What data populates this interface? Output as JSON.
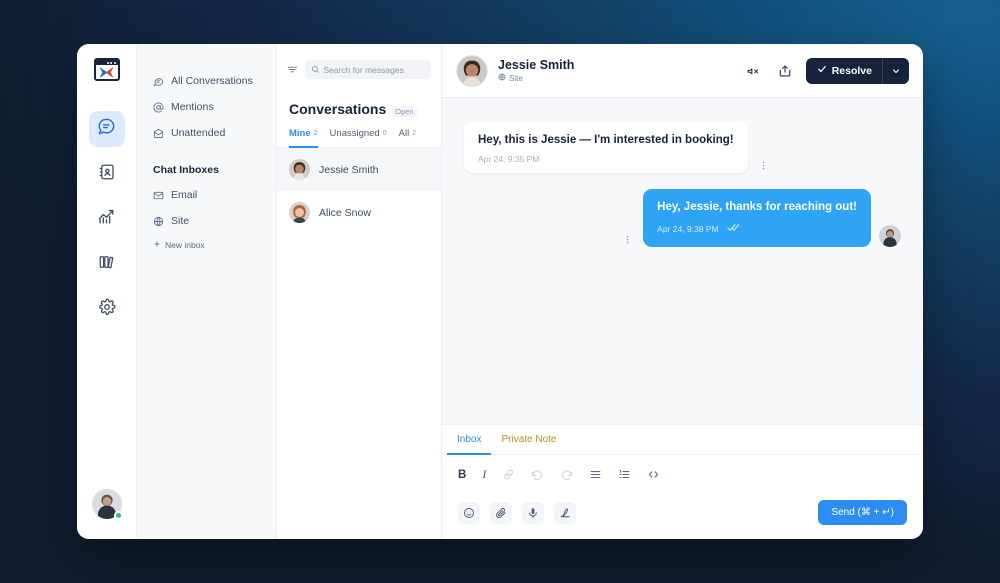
{
  "rail": {
    "logo_name": "app-logo",
    "items": [
      {
        "name": "conversations",
        "icon": "chat-icon",
        "active": true
      },
      {
        "name": "contacts",
        "icon": "contact-book-icon",
        "active": false
      },
      {
        "name": "reports",
        "icon": "chart-trend-icon",
        "active": false
      },
      {
        "name": "campaigns",
        "icon": "books-icon",
        "active": false
      },
      {
        "name": "settings",
        "icon": "gear-icon",
        "active": false
      }
    ],
    "avatar_status": "online"
  },
  "nav": {
    "items": [
      {
        "label": "All Conversations",
        "icon": "chat-bubble-icon"
      },
      {
        "label": "Mentions",
        "icon": "at-icon"
      },
      {
        "label": "Unattended",
        "icon": "envelope-open-icon"
      }
    ],
    "section_title": "Chat Inboxes",
    "inboxes": [
      {
        "label": "Email",
        "icon": "envelope-icon"
      },
      {
        "label": "Site",
        "icon": "globe-icon"
      }
    ],
    "new_inbox_label": "New inbox"
  },
  "conversation_list": {
    "search_placeholder": "Search for messages",
    "title": "Conversations",
    "status_badge": "Open",
    "tabs": [
      {
        "label": "Mine",
        "count": "2",
        "active": true
      },
      {
        "label": "Unassigned",
        "count": "0",
        "active": false
      },
      {
        "label": "All",
        "count": "2",
        "active": false
      }
    ],
    "rows": [
      {
        "name": "Jessie Smith",
        "selected": true
      },
      {
        "name": "Alice Snow",
        "selected": false
      }
    ]
  },
  "chat_header": {
    "contact_name": "Jessie Smith",
    "channel": "Site",
    "mute_icon": "speaker-mute-icon",
    "share_icon": "share-icon",
    "resolve_label": "Resolve"
  },
  "messages": [
    {
      "direction": "in",
      "text": "Hey, this is Jessie — I'm interested in booking!",
      "time": "Apr 24, 9:35 PM",
      "receipt": ""
    },
    {
      "direction": "out",
      "text": "Hey, Jessie, thanks for reaching out!",
      "time": "Apr 24, 9:38 PM",
      "receipt": "double-check-icon"
    }
  ],
  "composer": {
    "tabs": [
      {
        "label": "Inbox",
        "active": true
      },
      {
        "label": "Private Note",
        "active": false
      }
    ],
    "format_buttons": [
      {
        "name": "bold",
        "glyph": "B"
      },
      {
        "name": "italic",
        "glyph": "I"
      },
      {
        "name": "link",
        "glyph": "link-icon"
      },
      {
        "name": "undo",
        "glyph": "undo-icon"
      },
      {
        "name": "redo",
        "glyph": "redo-icon"
      },
      {
        "name": "bullet-list",
        "glyph": "bullet-list-icon"
      },
      {
        "name": "numbered-list",
        "glyph": "numbered-list-icon"
      },
      {
        "name": "code",
        "glyph": "code-icon"
      }
    ],
    "actions": [
      {
        "name": "emoji",
        "icon": "emoji-icon"
      },
      {
        "name": "attachment",
        "icon": "paperclip-icon"
      },
      {
        "name": "audio",
        "icon": "microphone-icon"
      },
      {
        "name": "signature",
        "icon": "signature-icon"
      }
    ],
    "send_label": "Send (⌘ + ↵)"
  },
  "colors": {
    "accent_blue": "#2d8cf0",
    "bubble_out": "#2fa3f4",
    "dark_navy": "#17233a",
    "note_amber": "#c48a2a",
    "online_green": "#27c46b"
  }
}
